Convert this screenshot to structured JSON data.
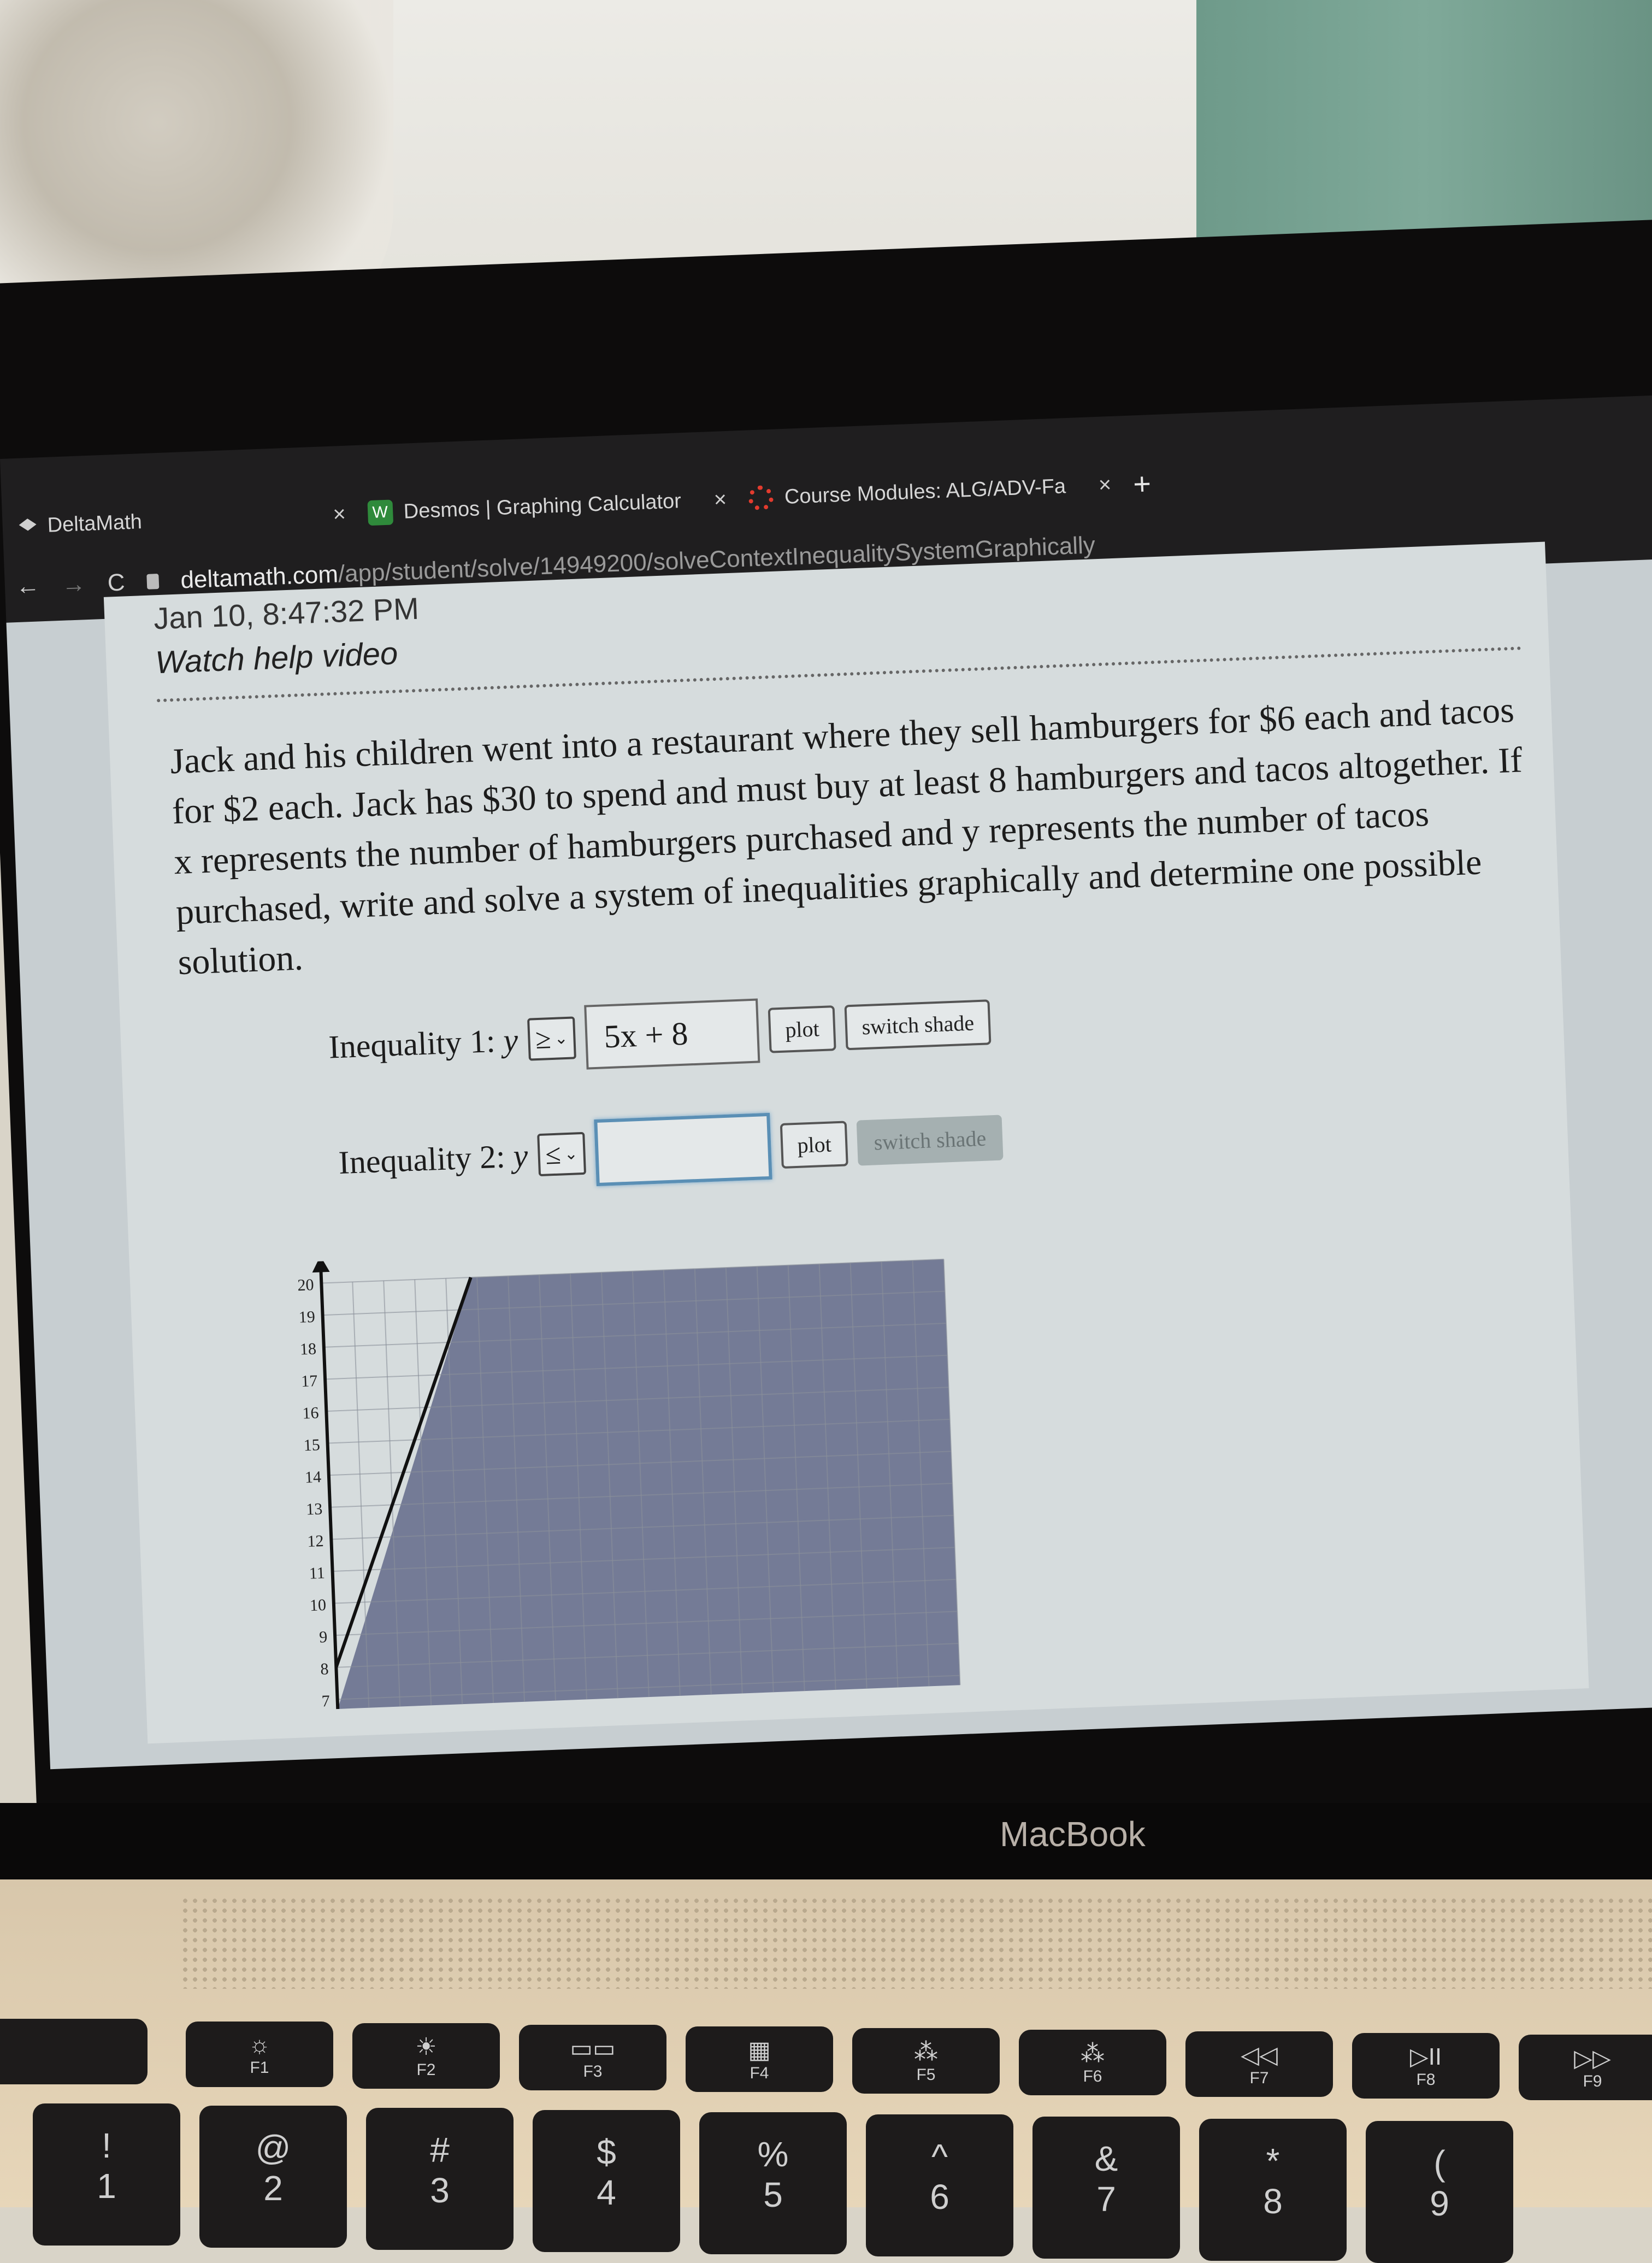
{
  "browser": {
    "tabs": [
      {
        "label": "DeltaMath",
        "icon": "graduation-cap-icon",
        "active": true
      },
      {
        "label": "Desmos | Graphing Calculator",
        "icon": "desmos-icon",
        "active": false
      },
      {
        "label": "Course Modules: ALG/ADV-Fa",
        "icon": "canvas-icon",
        "active": false
      }
    ],
    "close_glyph": "×",
    "new_tab_glyph": "+",
    "nav": {
      "back": "←",
      "forward": "→",
      "reload": "C"
    },
    "url_host": "deltamath.com",
    "url_path": "/app/student/solve/14949200/solveContextInequalitySystemGraphically"
  },
  "page": {
    "timestamp": "Jan 10, 8:47:32 PM",
    "help_link": "Watch help video",
    "problem": "Jack and his children went into a restaurant where they sell hamburgers for $6 each and tacos for $2 each. Jack has $30 to spend and must buy at least 8 hamburgers and tacos altogether. If x represents the number of hamburgers purchased and y represents the number of tacos purchased, write and solve a system of inequalities graphically and determine one possible solution.",
    "inequality1": {
      "label": "Inequality 1:",
      "var": "y",
      "operator": "≥",
      "expression": "5x + 8",
      "plot_label": "plot",
      "switch_label": "switch shade",
      "switch_enabled": true
    },
    "inequality2": {
      "label": "Inequality 2:",
      "var": "y",
      "operator": "≤",
      "expression": "",
      "plot_label": "plot",
      "switch_label": "switch shade",
      "switch_enabled": false
    }
  },
  "chart_data": {
    "type": "line",
    "title": "",
    "xlabel": "",
    "ylabel": "y",
    "xlim": [
      0,
      10
    ],
    "ylim": [
      6.7,
      20
    ],
    "x_grid_step": 0.5,
    "y_grid_step": 1,
    "y_tick_labels": [
      "7",
      "8",
      "9",
      "10",
      "11",
      "12",
      "13",
      "14",
      "15",
      "16",
      "17",
      "18",
      "19",
      "20"
    ],
    "series": [
      {
        "name": "y = 5x + 8",
        "slope": 5,
        "intercept": 8,
        "x": [
          0,
          2.4
        ],
        "y": [
          8,
          20
        ]
      }
    ],
    "shaded_region": "right of line (below y = 5x + 8)",
    "shade_color": "#747b96",
    "grid": true
  },
  "laptop": {
    "brand": "MacBook",
    "fkeys": [
      {
        "label": "F1",
        "glyph": "☼"
      },
      {
        "label": "F2",
        "glyph": "☀"
      },
      {
        "label": "F3",
        "glyph": "▭▭"
      },
      {
        "label": "F4",
        "glyph": "▦"
      },
      {
        "label": "F5",
        "glyph": "⁂"
      },
      {
        "label": "F6",
        "glyph": "⁂"
      },
      {
        "label": "F7",
        "glyph": "◁◁"
      },
      {
        "label": "F8",
        "glyph": "▷II"
      },
      {
        "label": "F9",
        "glyph": "▷▷"
      }
    ],
    "number_keys": [
      {
        "top": "!",
        "bottom": "1"
      },
      {
        "top": "@",
        "bottom": "2"
      },
      {
        "top": "#",
        "bottom": "3"
      },
      {
        "top": "$",
        "bottom": "4"
      },
      {
        "top": "%",
        "bottom": "5"
      },
      {
        "top": "^",
        "bottom": "6"
      },
      {
        "top": "&",
        "bottom": "7"
      },
      {
        "top": "*",
        "bottom": "8"
      },
      {
        "top": "(",
        "bottom": "9"
      }
    ]
  }
}
